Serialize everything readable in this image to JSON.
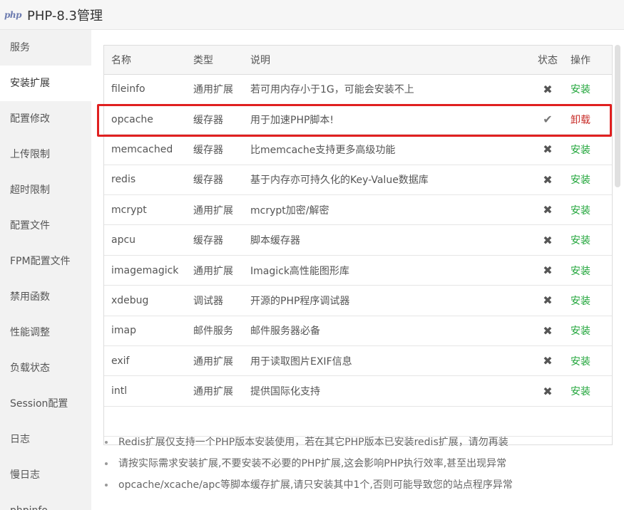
{
  "window": {
    "logo_text": "php",
    "title": "PHP-8.3管理"
  },
  "sidebar": {
    "items": [
      {
        "label": "服务"
      },
      {
        "label": "安装扩展"
      },
      {
        "label": "配置修改"
      },
      {
        "label": "上传限制"
      },
      {
        "label": "超时限制"
      },
      {
        "label": "配置文件"
      },
      {
        "label": "FPM配置文件"
      },
      {
        "label": "禁用函数"
      },
      {
        "label": "性能调整"
      },
      {
        "label": "负载状态"
      },
      {
        "label": "Session配置"
      },
      {
        "label": "日志"
      },
      {
        "label": "慢日志"
      },
      {
        "label": "phpinfo"
      }
    ],
    "active_index": 1
  },
  "table": {
    "headers": {
      "name": "名称",
      "type": "类型",
      "desc": "说明",
      "status": "状态",
      "action": "操作"
    },
    "rows": [
      {
        "name": "fileinfo",
        "type": "通用扩展",
        "desc": "若可用内存小于1G，可能会安装不上",
        "status": "✖",
        "action": "安装"
      },
      {
        "name": "opcache",
        "type": "缓存器",
        "desc": "用于加速PHP脚本!",
        "status": "✔",
        "action": "卸载"
      },
      {
        "name": "memcached",
        "type": "缓存器",
        "desc": "比memcache支持更多高级功能",
        "status": "✖",
        "action": "安装"
      },
      {
        "name": "redis",
        "type": "缓存器",
        "desc": "基于内存亦可持久化的Key-Value数据库",
        "status": "✖",
        "action": "安装"
      },
      {
        "name": "mcrypt",
        "type": "通用扩展",
        "desc": "mcrypt加密/解密",
        "status": "✖",
        "action": "安装"
      },
      {
        "name": "apcu",
        "type": "缓存器",
        "desc": "脚本缓存器",
        "status": "✖",
        "action": "安装"
      },
      {
        "name": "imagemagick",
        "type": "通用扩展",
        "desc": "Imagick高性能图形库",
        "status": "✖",
        "action": "安装"
      },
      {
        "name": "xdebug",
        "type": "调试器",
        "desc": "开源的PHP程序调试器",
        "status": "✖",
        "action": "安装"
      },
      {
        "name": "imap",
        "type": "邮件服务",
        "desc": "邮件服务器必备",
        "status": "✖",
        "action": "安装"
      },
      {
        "name": "exif",
        "type": "通用扩展",
        "desc": "用于读取图片EXIF信息",
        "status": "✖",
        "action": "安装"
      },
      {
        "name": "intl",
        "type": "通用扩展",
        "desc": "提供国际化支持",
        "status": "✖",
        "action": "安装"
      }
    ]
  },
  "notes": [
    "Redis扩展仅支持一个PHP版本安装使用，若在其它PHP版本已安装redis扩展，请勿再装",
    "请按实际需求安装扩展,不要安装不必要的PHP扩展,这会影响PHP执行效率,甚至出现异常",
    "opcache/xcache/apc等脚本缓存扩展,请只安装其中1个,否则可能导致您的站点程序异常"
  ],
  "colors": {
    "install": "#20a53a",
    "uninstall": "#c9302c",
    "highlight": "#e02020"
  }
}
